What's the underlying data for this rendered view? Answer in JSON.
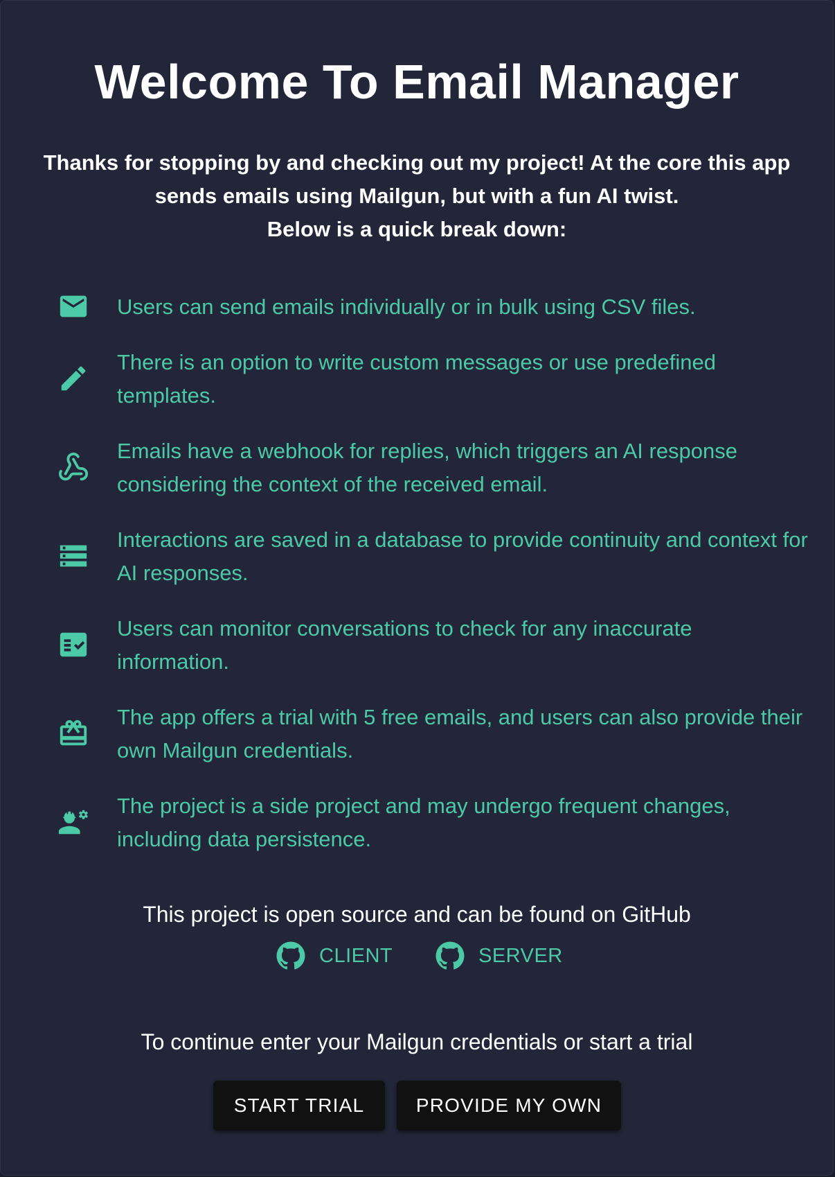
{
  "title": "Welcome To Email Manager",
  "intro": {
    "line1": "Thanks for stopping by and checking out my project! At the core this app sends emails using Mailgun, but with a fun AI twist.",
    "line2": "Below is a quick break down:"
  },
  "features": [
    {
      "icon": "email-icon",
      "text": "Users can send emails individually or in bulk using CSV files."
    },
    {
      "icon": "pencil-icon",
      "text": "There is an option to write custom messages or use predefined templates."
    },
    {
      "icon": "webhook-icon",
      "text": "Emails have a webhook for replies, which triggers an AI response considering the context of the received email."
    },
    {
      "icon": "database-list-icon",
      "text": "Interactions are saved in a database to provide continuity and context for AI responses."
    },
    {
      "icon": "checklist-icon",
      "text": "Users can monitor conversations to check for any inaccurate information."
    },
    {
      "icon": "gift-card-icon",
      "text": "The app offers a trial with 5 free emails, and users can also provide their own Mailgun credentials."
    },
    {
      "icon": "engineer-icon",
      "text": "The project is a side project and may undergo frequent changes, including data persistence."
    }
  ],
  "github": {
    "text": "This project is open source and can be found on GitHub",
    "client_label": "CLIENT",
    "server_label": "SERVER"
  },
  "continue_text": "To continue enter your Mailgun credentials or start a trial",
  "buttons": {
    "start_trial": "START TRIAL",
    "provide_own": "PROVIDE MY OWN"
  },
  "colors": {
    "background": "#222638",
    "accent": "#4cc9a6",
    "button": "#111111"
  }
}
